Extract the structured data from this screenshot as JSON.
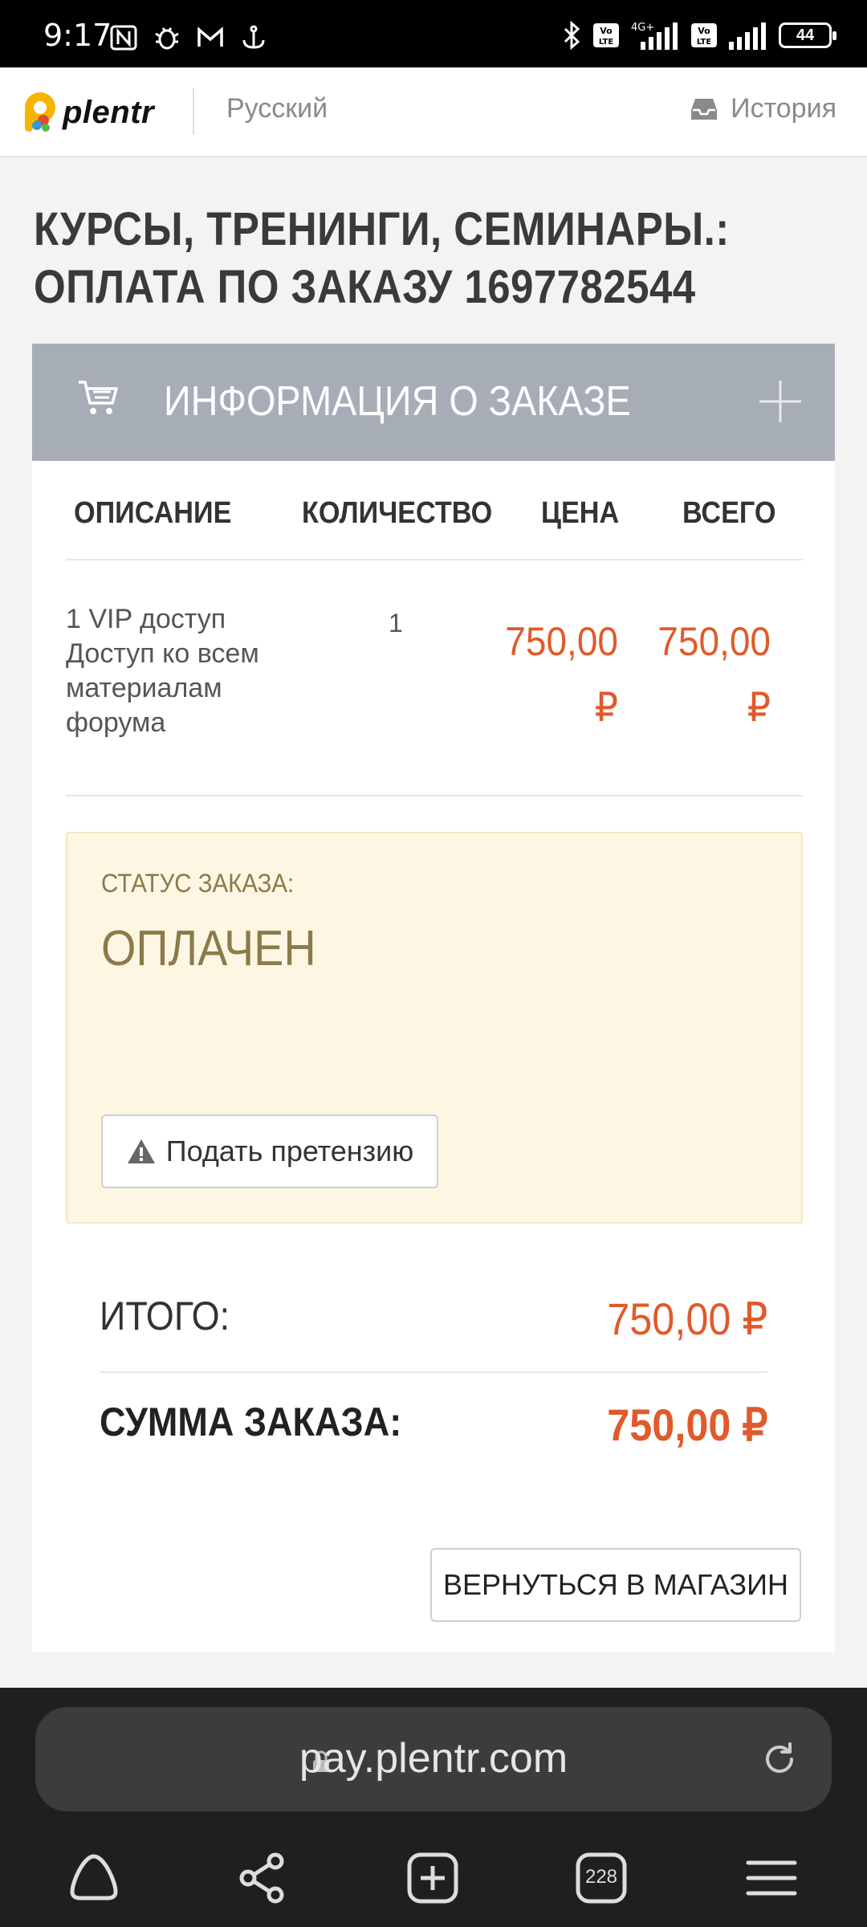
{
  "status_bar": {
    "time": "9:17",
    "battery": "44"
  },
  "header": {
    "logo_text": "plentr",
    "language": "Русский",
    "history": "История"
  },
  "page": {
    "title": "КУРСЫ, ТРЕНИНГИ, СЕМИНАРЫ.: ОПЛАТА ПО ЗАКАЗУ 1697782544"
  },
  "order_panel": {
    "title": "ИНФОРМАЦИЯ О ЗАКАЗЕ",
    "columns": {
      "description": "ОПИСАНИЕ",
      "quantity": "КОЛИЧЕСТВО",
      "price": "ЦЕНА",
      "total": "ВСЕГО"
    },
    "items": [
      {
        "description": "1 VIP доступ Доступ ко всем материалам форума",
        "quantity": "1",
        "price": "750,00 ₽",
        "total": "750,00 ₽"
      }
    ]
  },
  "status": {
    "label": "СТАТУС ЗАКАЗА:",
    "value": "ОПЛАЧЕН",
    "claim_button": "Подать претензию"
  },
  "totals": {
    "subtotal_label": "ИТОГО:",
    "subtotal_value": "750,00 ₽",
    "sum_label": "СУММА ЗАКАЗА:",
    "sum_value": "750,00 ₽"
  },
  "back_button": "ВЕРНУТЬСЯ В МАГАЗИН",
  "browser": {
    "url": "pay.plentr.com",
    "tab_count": "228"
  },
  "colors": {
    "accent": "#e05a2b",
    "panel_header": "#a6adb6",
    "status_bg": "#fcf6e3",
    "status_text": "#8b7a4a"
  }
}
